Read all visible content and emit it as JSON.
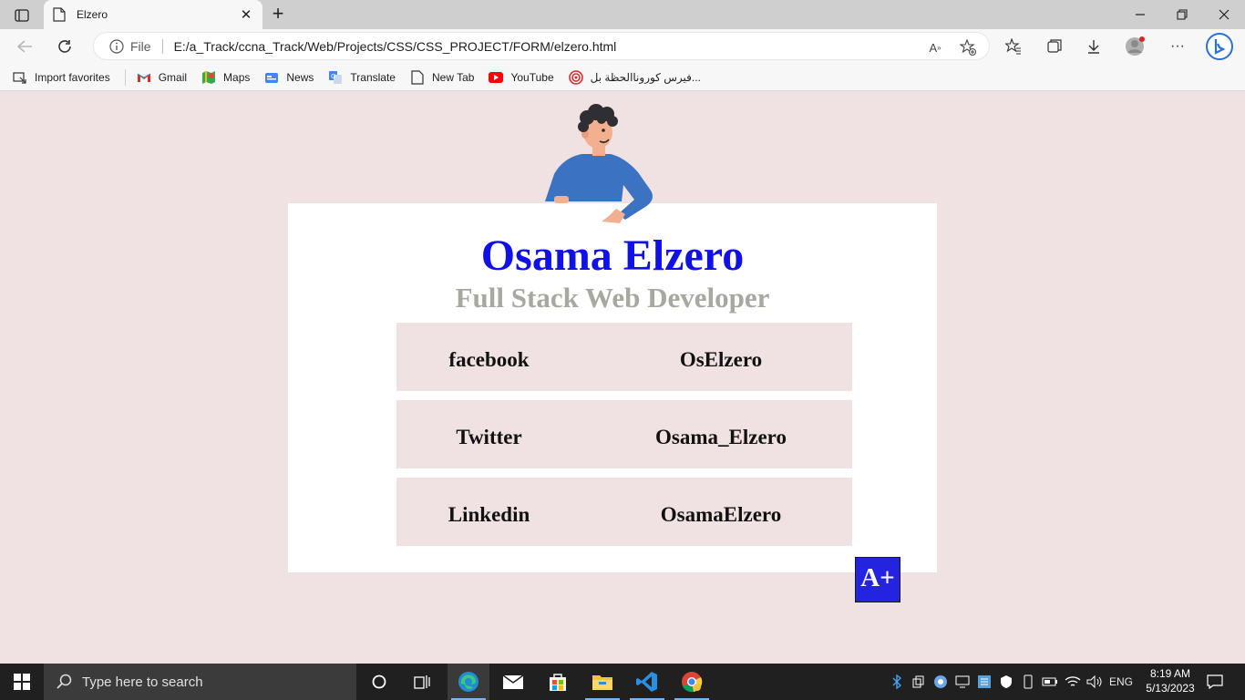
{
  "browser": {
    "tab_title": "Elzero",
    "address_prefix": "File",
    "url": "E:/a_Track/ccna_Track/Web/Projects/CSS/CSS_PROJECT/FORM/elzero.html",
    "favorites": [
      {
        "label": "Import favorites",
        "icon": "import-icon"
      },
      {
        "label": "Gmail",
        "icon": "gmail-icon"
      },
      {
        "label": "Maps",
        "icon": "maps-icon"
      },
      {
        "label": "News",
        "icon": "news-icon"
      },
      {
        "label": "Translate",
        "icon": "translate-icon"
      },
      {
        "label": "New Tab",
        "icon": "page-icon"
      },
      {
        "label": "YouTube",
        "icon": "youtube-icon"
      },
      {
        "label": "فيرس كوروناالحظة بل...",
        "icon": "target-icon"
      }
    ]
  },
  "page": {
    "name": "Osama Elzero",
    "role": "Full Stack Web Developer",
    "socials": [
      {
        "network": "facebook",
        "handle": "OsElzero"
      },
      {
        "network": "Twitter",
        "handle": "Osama_Elzero"
      },
      {
        "network": "Linkedin",
        "handle": "OsamaElzero"
      }
    ],
    "badge": "A+",
    "colors": {
      "name": "#1010e8",
      "role": "#a8a8a0",
      "background": "#f0e2e2",
      "badge": "#2424e0"
    }
  },
  "taskbar": {
    "search_placeholder": "Type here to search",
    "language": "ENG",
    "time": "8:19 AM",
    "date": "5/13/2023"
  }
}
